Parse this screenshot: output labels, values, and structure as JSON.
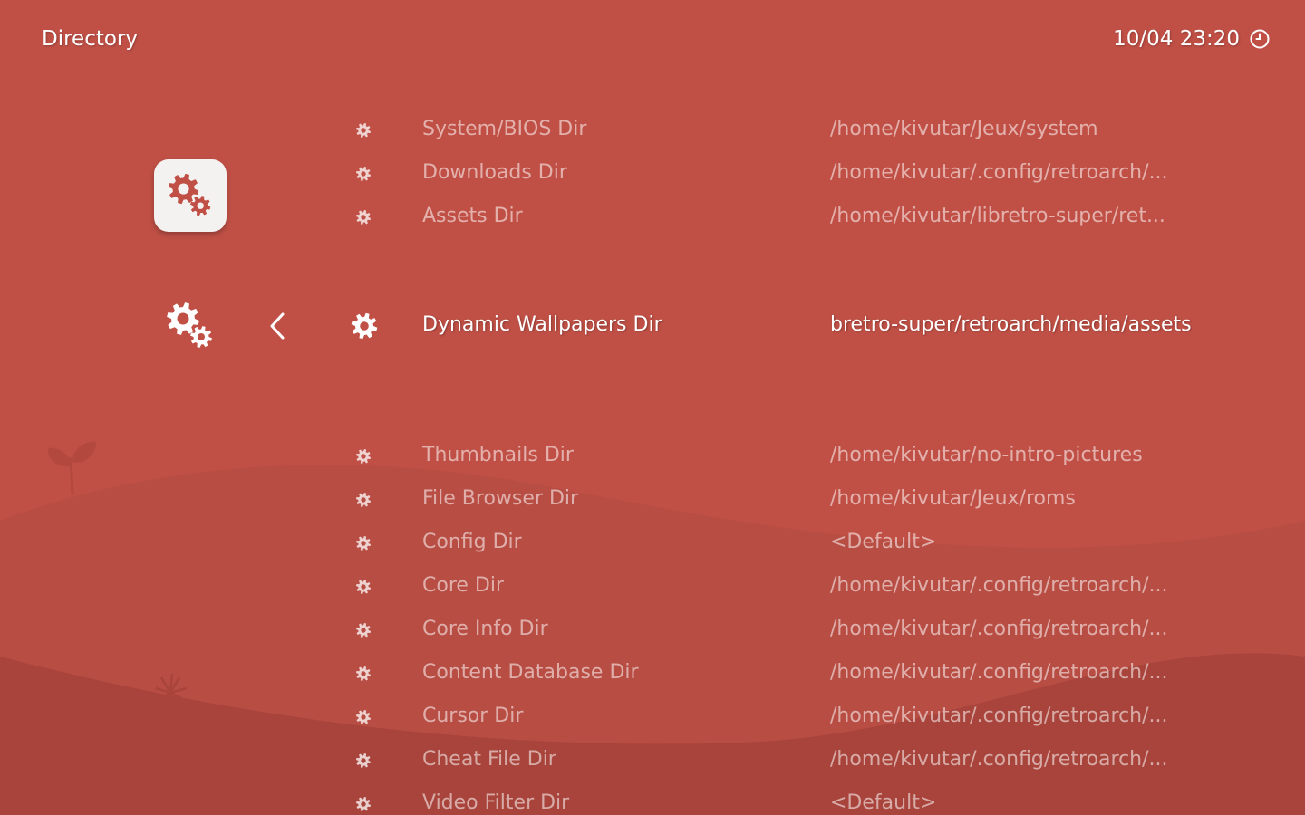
{
  "header": {
    "title": "Directory",
    "clock": "10/04 23:20"
  },
  "theme": {
    "background": "#c05046",
    "accent": "#ffffff",
    "tile": "#f4f2f1"
  },
  "icons": {
    "category": "settings-gears-icon",
    "subcategory": "settings-gears-icon",
    "back": "chevron-left-icon",
    "row": "gear-icon",
    "clock": "clock-icon"
  },
  "menu": {
    "selected_index": 3,
    "items": [
      {
        "label": "System/BIOS Dir",
        "value": "/home/kivutar/Jeux/system"
      },
      {
        "label": "Downloads Dir",
        "value": "/home/kivutar/.config/retroarch/..."
      },
      {
        "label": "Assets Dir",
        "value": "/home/kivutar/libretro-super/ret..."
      },
      {
        "label": "Dynamic Wallpapers Dir",
        "value": "bretro-super/retroarch/media/assets"
      },
      {
        "label": "Thumbnails Dir",
        "value": "/home/kivutar/no-intro-pictures"
      },
      {
        "label": "File Browser Dir",
        "value": "/home/kivutar/Jeux/roms"
      },
      {
        "label": "Config Dir",
        "value": "<Default>"
      },
      {
        "label": "Core Dir",
        "value": "/home/kivutar/.config/retroarch/..."
      },
      {
        "label": "Core Info Dir",
        "value": "/home/kivutar/.config/retroarch/..."
      },
      {
        "label": "Content Database Dir",
        "value": "/home/kivutar/.config/retroarch/..."
      },
      {
        "label": "Cursor Dir",
        "value": "/home/kivutar/.config/retroarch/..."
      },
      {
        "label": "Cheat File Dir",
        "value": "/home/kivutar/.config/retroarch/..."
      },
      {
        "label": "Video Filter Dir",
        "value": "<Default>"
      }
    ]
  }
}
